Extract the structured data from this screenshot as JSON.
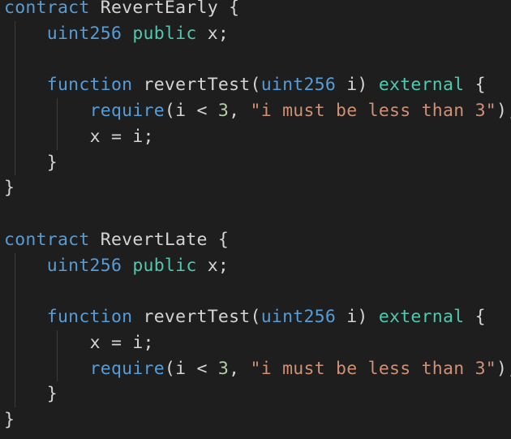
{
  "colors": {
    "background": "#1e1e1e",
    "text": "#d4d4d4",
    "keyword": "#569cd6",
    "modifier": "#4ec9b0",
    "number": "#b5cea8",
    "string": "#ce9178",
    "indent_guide": "#3c3c3c"
  },
  "lines": [
    {
      "guides": 0,
      "tokens": [
        {
          "t": "contract",
          "c": "kw-storage"
        },
        {
          "t": " RevertEarly {",
          "c": "plain"
        }
      ]
    },
    {
      "guides": 1,
      "tokens": [
        {
          "t": "    ",
          "c": "plain"
        },
        {
          "t": "uint256",
          "c": "kw-type"
        },
        {
          "t": " ",
          "c": "plain"
        },
        {
          "t": "public",
          "c": "kw-mod"
        },
        {
          "t": " x;",
          "c": "plain"
        }
      ]
    },
    {
      "guides": 1,
      "tokens": []
    },
    {
      "guides": 1,
      "tokens": [
        {
          "t": "    ",
          "c": "plain"
        },
        {
          "t": "function",
          "c": "kw-func"
        },
        {
          "t": " revertTest(",
          "c": "plain"
        },
        {
          "t": "uint256",
          "c": "kw-type"
        },
        {
          "t": " i) ",
          "c": "plain"
        },
        {
          "t": "external",
          "c": "kw-mod"
        },
        {
          "t": " {",
          "c": "plain"
        }
      ]
    },
    {
      "guides": 2,
      "tokens": [
        {
          "t": "        ",
          "c": "plain"
        },
        {
          "t": "require",
          "c": "fn-call"
        },
        {
          "t": "(i < ",
          "c": "plain"
        },
        {
          "t": "3",
          "c": "num"
        },
        {
          "t": ", ",
          "c": "plain"
        },
        {
          "t": "\"i must be less than 3\"",
          "c": "str"
        },
        {
          "t": ");",
          "c": "plain"
        }
      ]
    },
    {
      "guides": 2,
      "tokens": [
        {
          "t": "        ",
          "c": "plain"
        },
        {
          "t": "x = i;",
          "c": "plain"
        }
      ]
    },
    {
      "guides": 1,
      "tokens": [
        {
          "t": "    ",
          "c": "plain"
        },
        {
          "t": "}",
          "c": "plain"
        }
      ]
    },
    {
      "guides": 0,
      "tokens": [
        {
          "t": "}",
          "c": "plain"
        }
      ]
    },
    {
      "guides": 0,
      "tokens": []
    },
    {
      "guides": 0,
      "tokens": [
        {
          "t": "contract",
          "c": "kw-storage"
        },
        {
          "t": " RevertLate {",
          "c": "plain"
        }
      ]
    },
    {
      "guides": 1,
      "tokens": [
        {
          "t": "    ",
          "c": "plain"
        },
        {
          "t": "uint256",
          "c": "kw-type"
        },
        {
          "t": " ",
          "c": "plain"
        },
        {
          "t": "public",
          "c": "kw-mod"
        },
        {
          "t": " x;",
          "c": "plain"
        }
      ]
    },
    {
      "guides": 1,
      "tokens": []
    },
    {
      "guides": 1,
      "tokens": [
        {
          "t": "    ",
          "c": "plain"
        },
        {
          "t": "function",
          "c": "kw-func"
        },
        {
          "t": " revertTest(",
          "c": "plain"
        },
        {
          "t": "uint256",
          "c": "kw-type"
        },
        {
          "t": " i) ",
          "c": "plain"
        },
        {
          "t": "external",
          "c": "kw-mod"
        },
        {
          "t": " {",
          "c": "plain"
        }
      ]
    },
    {
      "guides": 2,
      "tokens": [
        {
          "t": "        ",
          "c": "plain"
        },
        {
          "t": "x = i;",
          "c": "plain"
        }
      ]
    },
    {
      "guides": 2,
      "tokens": [
        {
          "t": "        ",
          "c": "plain"
        },
        {
          "t": "require",
          "c": "fn-call"
        },
        {
          "t": "(i < ",
          "c": "plain"
        },
        {
          "t": "3",
          "c": "num"
        },
        {
          "t": ", ",
          "c": "plain"
        },
        {
          "t": "\"i must be less than 3\"",
          "c": "str"
        },
        {
          "t": ");",
          "c": "plain"
        }
      ]
    },
    {
      "guides": 1,
      "tokens": [
        {
          "t": "    ",
          "c": "plain"
        },
        {
          "t": "}",
          "c": "plain"
        }
      ]
    },
    {
      "guides": 0,
      "tokens": [
        {
          "t": "}",
          "c": "plain"
        }
      ]
    }
  ]
}
